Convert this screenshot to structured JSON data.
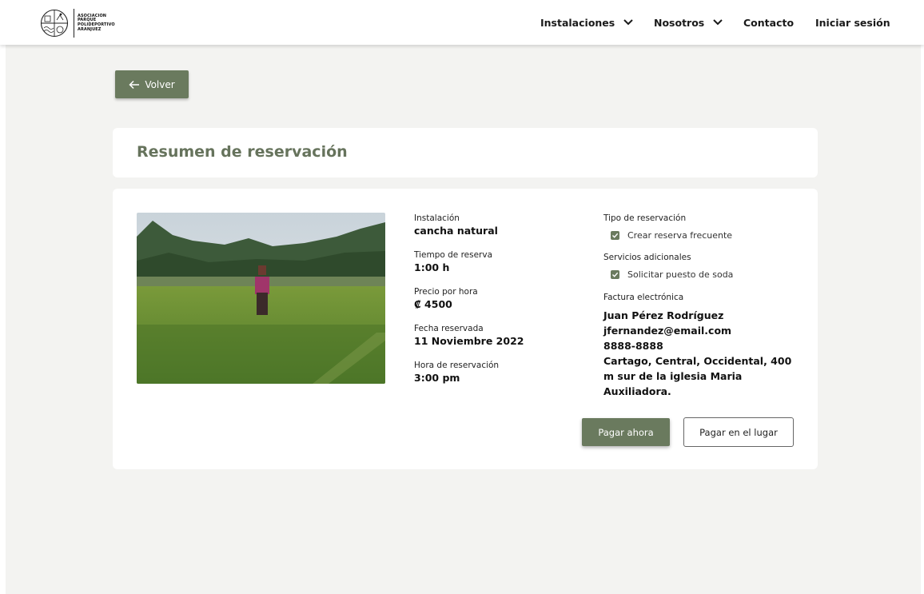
{
  "brand": {
    "logo_lines": [
      "ASOCIACION",
      "PARQUE",
      "POLIDEPORTIVO",
      "ARANJUEZ"
    ]
  },
  "nav": {
    "instalaciones": "Instalaciones",
    "nosotros": "Nosotros",
    "contacto": "Contacto",
    "login": "Iniciar sesión"
  },
  "back_label": "Volver",
  "summary": {
    "title": "Resumen de reservación"
  },
  "details": {
    "instalacion": {
      "label": "Instalación",
      "value": "cancha natural"
    },
    "tiempo": {
      "label": "Tiempo de reserva",
      "value": "1:00 h"
    },
    "precio": {
      "label": "Precio por hora",
      "value": "₡ 4500"
    },
    "fecha": {
      "label": "Fecha reservada",
      "value": "11 Noviembre 2022"
    },
    "hora": {
      "label": "Hora de reservación",
      "value": "3:00 pm"
    }
  },
  "options": {
    "tipo_label": "Tipo de reservación",
    "frecuente_label": "Crear reserva frecuente",
    "frecuente_checked": true,
    "servicios_label": "Servicios adicionales",
    "soda_label": "Solicitar puesto de soda",
    "soda_checked": true
  },
  "factura": {
    "label": "Factura electrónica",
    "name": "Juan Pérez Rodríguez",
    "email": "jfernandez@email.com",
    "phone": "8888-8888",
    "address": "Cartago, Central, Occidental, 400 m sur de la iglesia Maria Auxiliadora."
  },
  "actions": {
    "pay_now": "Pagar ahora",
    "pay_place": "Pagar en el lugar"
  },
  "colors": {
    "accent": "#6a7a5e",
    "title": "#66735c",
    "background": "#f3f3f1"
  }
}
